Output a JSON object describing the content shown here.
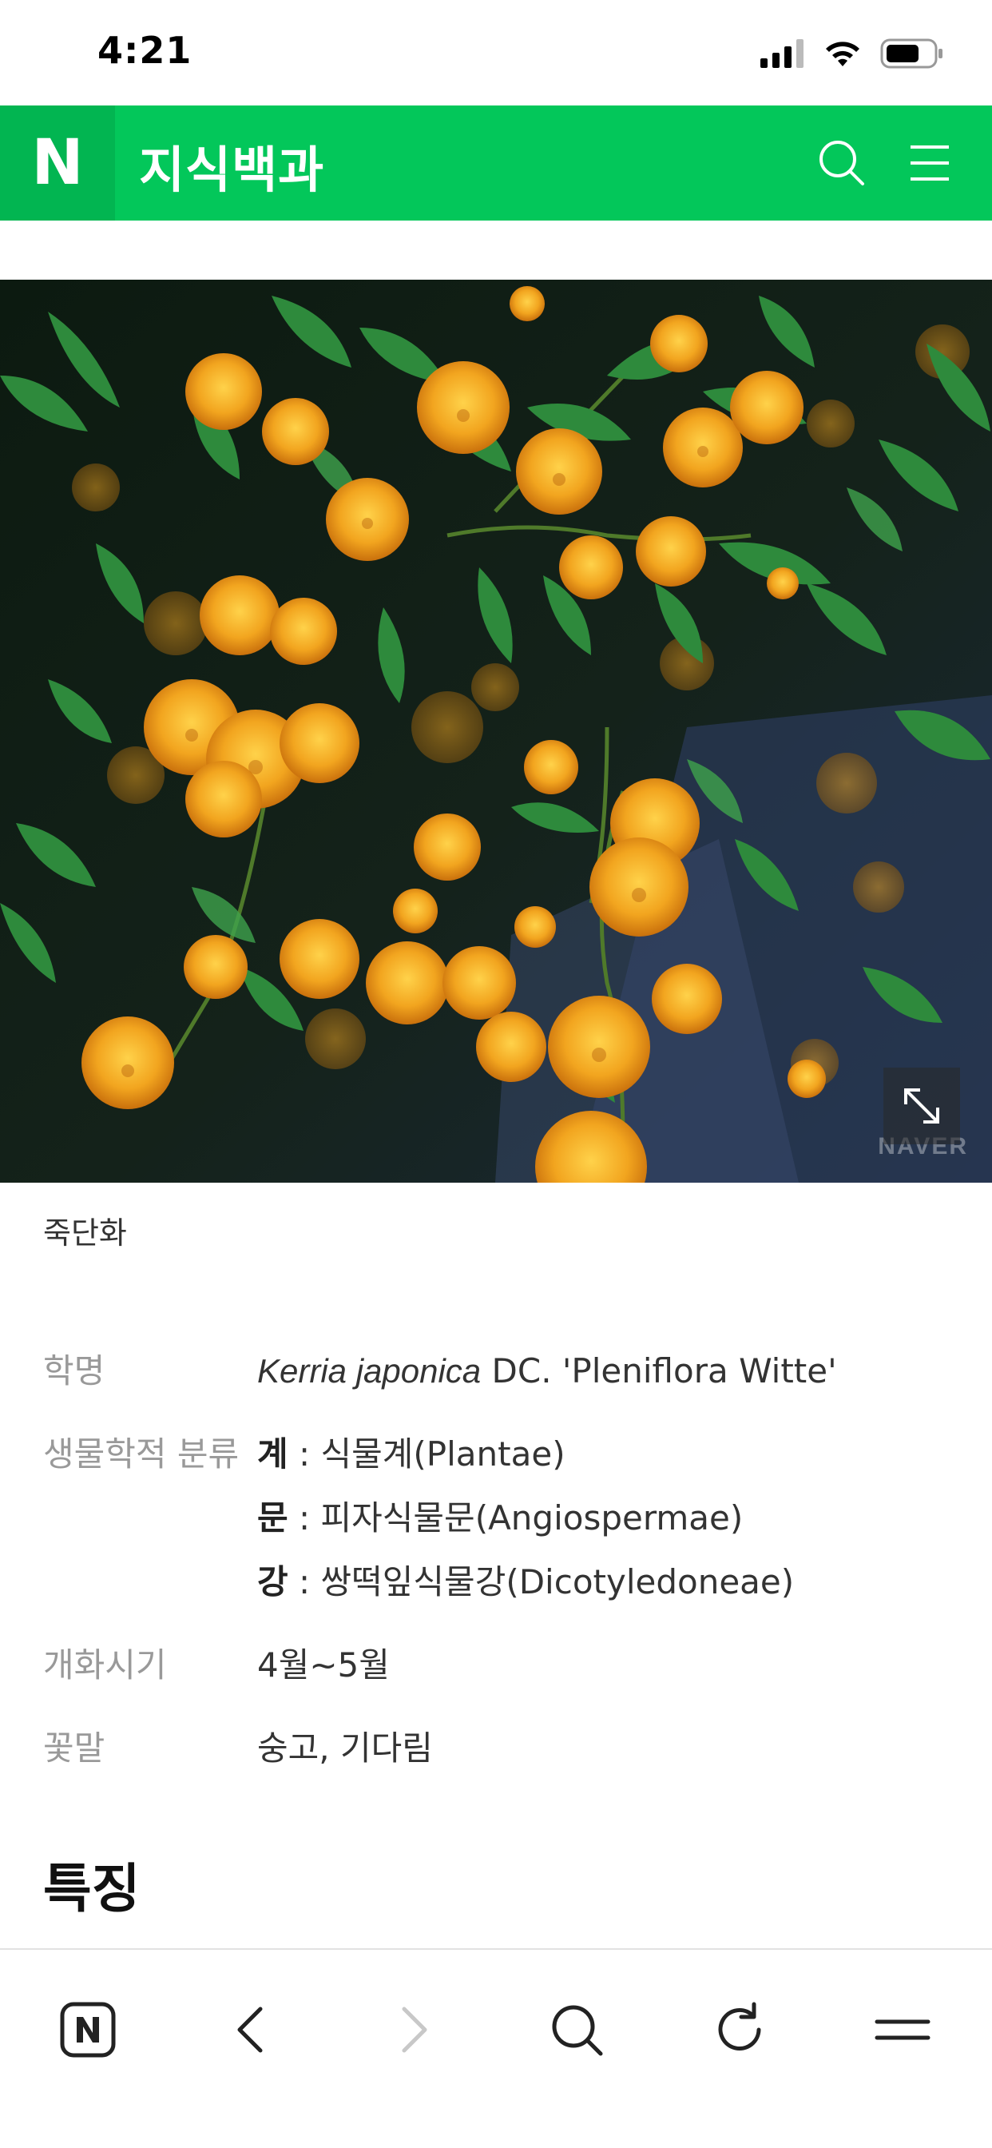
{
  "status_bar": {
    "time": "4:21"
  },
  "header": {
    "logo": "N",
    "title": "지식백과",
    "icons": [
      "search-icon",
      "hamburger-menu-icon"
    ]
  },
  "photo": {
    "watermark": "NAVER",
    "expand_icon": "expand-icon"
  },
  "caption": "죽단화",
  "info": {
    "scientific_name": {
      "label": "학명",
      "italic": "Kerria japonica",
      "rest": " DC. 'Pleniflora Witte'"
    },
    "classification": {
      "label": "생물학적 분류",
      "rows": [
        {
          "rank": "계",
          "value": " : 식물계(Plantae)"
        },
        {
          "rank": "문",
          "value": " : 피자식물문(Angiospermae)"
        },
        {
          "rank": "강",
          "value": " : 쌍떡잎식물강(Dicotyledoneae)"
        }
      ]
    },
    "bloom": {
      "label": "개화시기",
      "value": "4월~5월"
    },
    "flower_language": {
      "label": "꽃말",
      "value": "숭고, 기다림"
    }
  },
  "section_title": "특징",
  "toolbar": {
    "icons": [
      "naver-home-icon",
      "back-icon",
      "forward-icon",
      "search-icon",
      "reload-icon",
      "menu-icon"
    ]
  },
  "colors": {
    "brand_green": "#03c75a",
    "flower": "#f2a51f",
    "leaf": "#2e8a3c"
  }
}
